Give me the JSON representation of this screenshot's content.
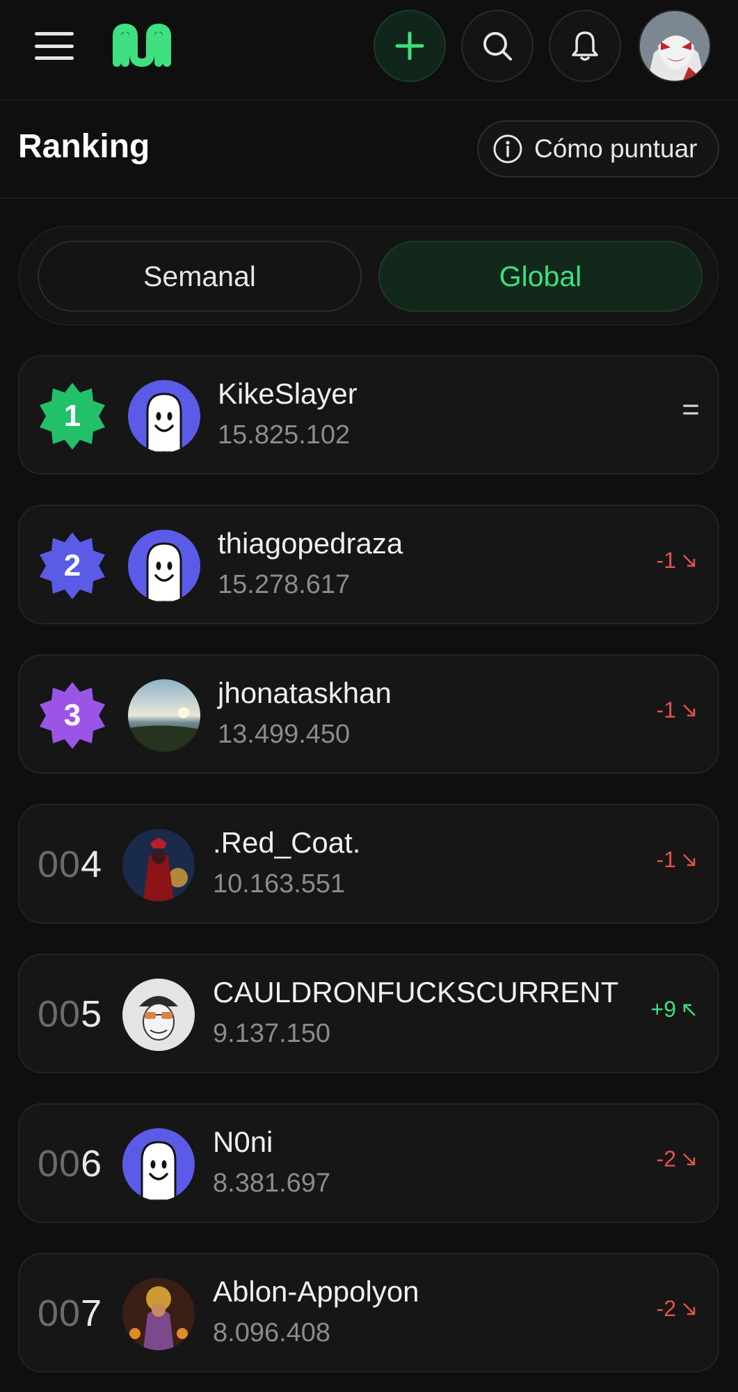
{
  "topbar": {
    "menu_icon": "hamburger-icon",
    "logo_icon": "brand-logo",
    "add_icon": "plus-icon",
    "search_icon": "search-icon",
    "bell_icon": "bell-icon",
    "accent_color": "#3ee07f"
  },
  "header": {
    "title": "Ranking",
    "howto_label": "Cómo puntuar",
    "howto_icon": "info-icon"
  },
  "tabs": [
    {
      "label": "Semanal",
      "active": false
    },
    {
      "label": "Global",
      "active": true
    }
  ],
  "ranking": [
    {
      "rank": "1",
      "prefix": "",
      "name": "KikeSlayer",
      "score": "15.825.102",
      "change": "=",
      "trend": "same",
      "badge_color": "#22c06a",
      "avatar": "ghost"
    },
    {
      "rank": "2",
      "prefix": "",
      "name": "thiagopedraza",
      "score": "15.278.617",
      "change": "-1",
      "trend": "down",
      "badge_color": "#5b5be8",
      "avatar": "ghost"
    },
    {
      "rank": "3",
      "prefix": "",
      "name": "jhonataskhan",
      "score": "13.499.450",
      "change": "-1",
      "trend": "down",
      "badge_color": "#9b55e6",
      "avatar": "beach"
    },
    {
      "rank": "4",
      "prefix": "00",
      "name": ".Red_Coat.",
      "score": "10.163.551",
      "change": "-1",
      "trend": "down",
      "avatar": "redcoat"
    },
    {
      "rank": "5",
      "prefix": "00",
      "name": "CAULDRONFUCKSCURRENT",
      "score": "9.137.150",
      "change": "+9",
      "trend": "up",
      "avatar": "sketch"
    },
    {
      "rank": "6",
      "prefix": "00",
      "name": "N0ni",
      "score": "8.381.697",
      "change": "-2",
      "trend": "down",
      "avatar": "ghost"
    },
    {
      "rank": "7",
      "prefix": "00",
      "name": "Ablon-Appolyon",
      "score": "8.096.408",
      "change": "-2",
      "trend": "down",
      "avatar": "warrior"
    }
  ]
}
